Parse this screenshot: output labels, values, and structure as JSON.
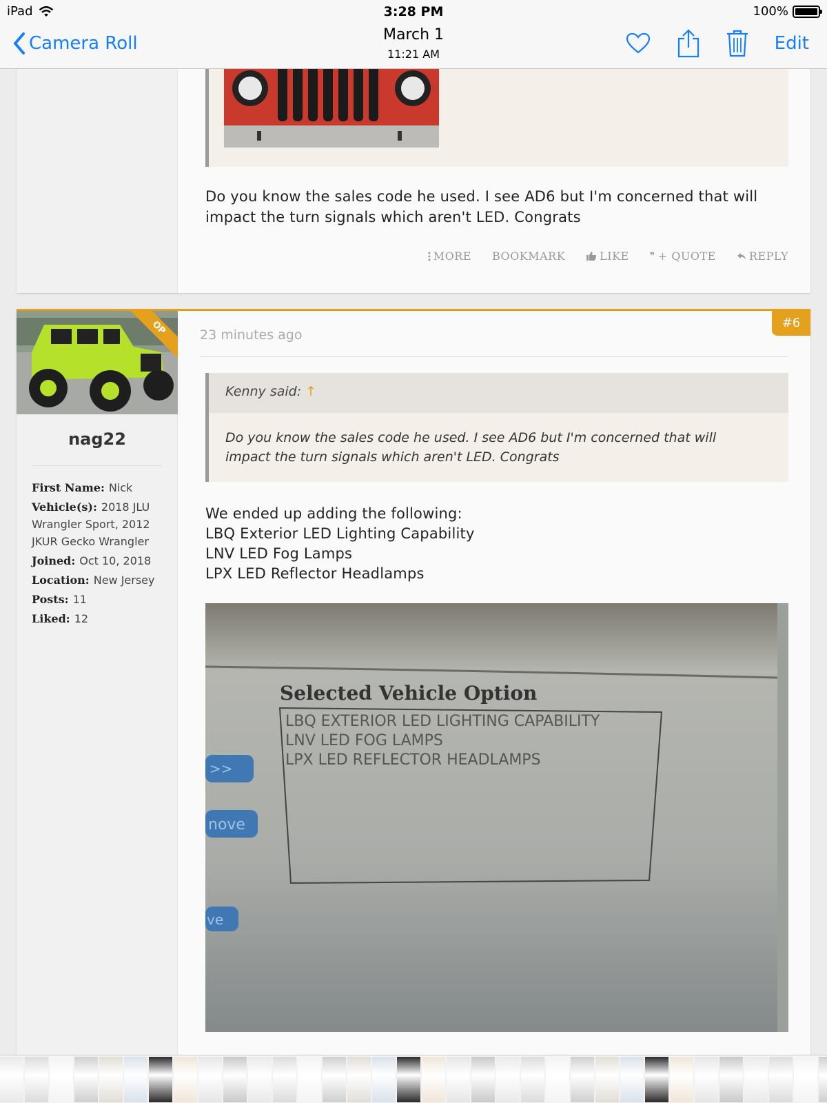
{
  "status_bar": {
    "device": "iPad",
    "time": "3:28 PM",
    "battery": "100%",
    "battery_level": 1.0
  },
  "nav": {
    "back_label": "Camera Roll",
    "date": "March 1",
    "time": "11:21 AM",
    "edit_label": "Edit",
    "icons": [
      "heart-icon",
      "share-icon",
      "trash-icon"
    ],
    "accent_color": "#157efb"
  },
  "post1": {
    "text_line1": "Do you know the sales code he used. I see AD6 but I'm concerned that will",
    "text_line2": "impact the turn signals which aren't LED. Congrats",
    "actions": {
      "more": "MORE",
      "bookmark": "BOOKMARK",
      "like": "LIKE",
      "quote": "+ QUOTE",
      "reply": "REPLY"
    }
  },
  "post2": {
    "number": "#6",
    "timestamp": "23 minutes ago",
    "op_badge": "OP",
    "user": {
      "username": "nag22",
      "first_name_label": "First Name:",
      "first_name": "Nick",
      "vehicles_label": "Vehicle(s):",
      "vehicles": "2018 JLU Wrangler Sport, 2012 JKUR Gecko Wrangler",
      "joined_label": "Joined:",
      "joined": "Oct 10, 2018",
      "location_label": "Location:",
      "location": "New Jersey",
      "posts_label": "Posts:",
      "posts": "11",
      "liked_label": "Liked:",
      "liked": "12"
    },
    "quote": {
      "author_line": "Kenny said:",
      "line1": "Do you know the sales code he used. I see AD6 but I'm concerned that will",
      "line2": "impact the turn signals which aren't LED. Congrats"
    },
    "body": [
      "We ended up adding the following:",
      "LBQ Exterior LED Lighting Capability",
      "LNV LED Fog Lamps",
      "LPX LED Reflector Headlamps"
    ],
    "photo": {
      "title": "Selected Vehicle Option",
      "options": [
        "LBQ EXTERIOR LED LIGHTING CAPABILITY",
        "LNV LED FOG LAMPS",
        "LPX LED REFLECTOR HEADLAMPS"
      ],
      "side_buttons": [
        ">>",
        "nove",
        "ve"
      ]
    },
    "accent_color": "#e5a11d"
  }
}
